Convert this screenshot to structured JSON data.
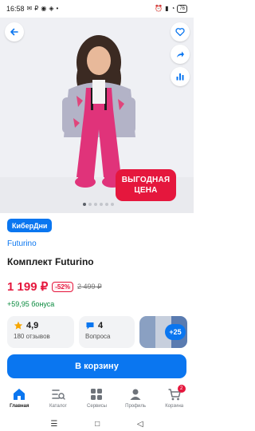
{
  "status_bar": {
    "time": "16:58",
    "battery": "76"
  },
  "hero": {
    "promo_line1": "ВЫГОДНАЯ",
    "promo_line2": "ЦЕНА",
    "slide_count": 6,
    "active_slide": 1
  },
  "product": {
    "badge": "КиберДни",
    "brand": "Futurino",
    "title": "Комплект Futurino",
    "price": "1 199 ₽",
    "discount": "-52%",
    "old_price": "2 499 ₽",
    "bonus": "+59,95 бонуса"
  },
  "reviews": {
    "rating": "4,9",
    "count_label": "180 отзывов"
  },
  "questions": {
    "count": "4",
    "label": "Вопроса"
  },
  "photos": {
    "more_label": "+25"
  },
  "cart_button": {
    "label": "В корзину"
  },
  "bottom_nav": {
    "items": [
      {
        "label": "Главная",
        "icon": "home-icon"
      },
      {
        "label": "Каталог",
        "icon": "catalog-icon"
      },
      {
        "label": "Сервисы",
        "icon": "services-icon"
      },
      {
        "label": "Профиль",
        "icon": "profile-icon"
      },
      {
        "label": "Корзина",
        "icon": "cart-icon",
        "badge": "2"
      }
    ]
  },
  "colors": {
    "accent": "#0a76f0",
    "price": "#e5173d",
    "bonus": "#0a8a3e"
  }
}
